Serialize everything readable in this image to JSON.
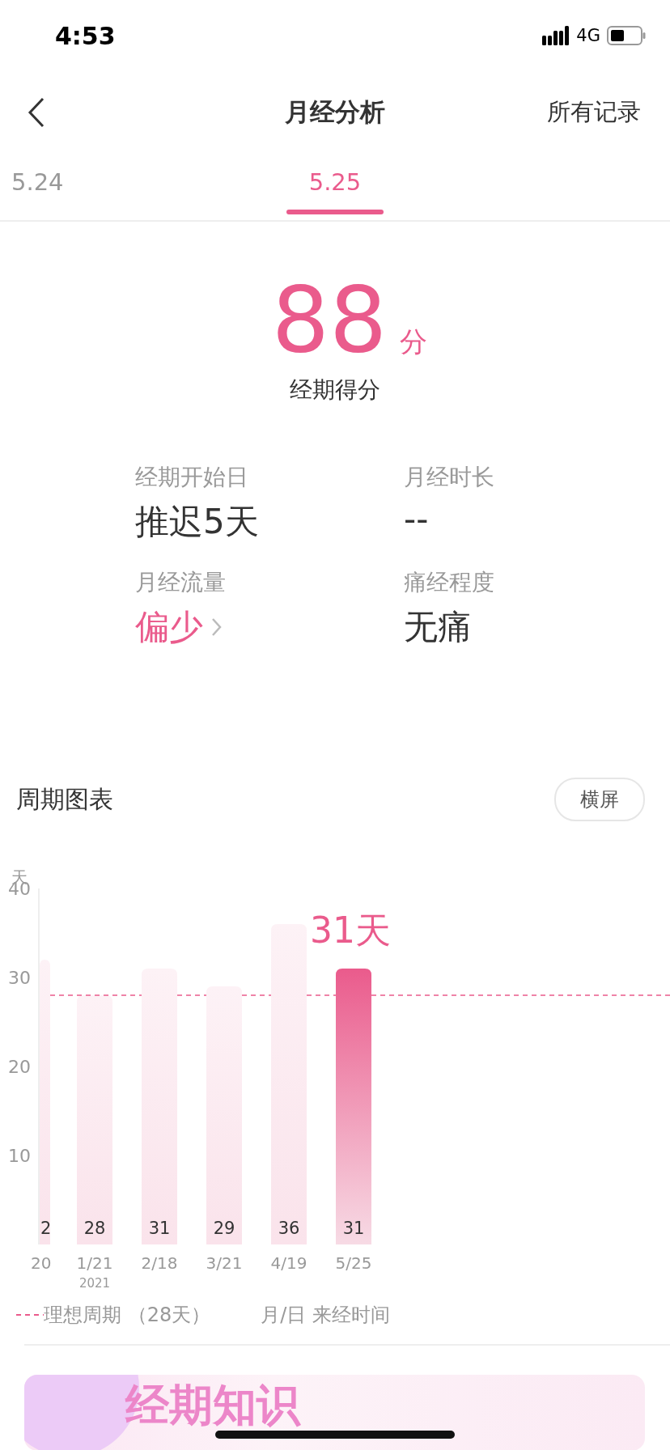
{
  "status_bar": {
    "time": "4:53",
    "network": "4G"
  },
  "nav": {
    "title": "月经分析",
    "action": "所有记录"
  },
  "tabs": [
    {
      "label": "5.24",
      "selected": false
    },
    {
      "label": "5.25",
      "selected": true
    }
  ],
  "score": {
    "value": "88",
    "unit": "分",
    "caption": "经期得分"
  },
  "stats": [
    {
      "label": "经期开始日",
      "value": "推迟5天",
      "link": false
    },
    {
      "label": "月经时长",
      "value": "--",
      "link": false
    },
    {
      "label": "月经流量",
      "value": "偏少",
      "link": true
    },
    {
      "label": "痛经程度",
      "value": "无痛",
      "link": false
    }
  ],
  "cycle_chart": {
    "title": "周期图表",
    "button": "横屏",
    "chart_data": {
      "type": "bar",
      "ylabel": "天",
      "categories": [
        "1/21",
        "2/18",
        "3/21",
        "4/19",
        "5/25"
      ],
      "values": [
        28,
        31,
        29,
        36,
        31
      ],
      "value_labels": [
        "28",
        "31",
        "29",
        "36",
        "31"
      ],
      "ylim": [
        0,
        40
      ],
      "yticks": [
        10,
        20,
        30,
        40
      ],
      "annotations": [
        "31天",
        "2021"
      ]
    },
    "bars": [
      {
        "selected": false
      },
      {
        "selected": false
      },
      {
        "selected": false
      },
      {
        "selected": false
      },
      {
        "selected": true
      }
    ],
    "cut_bar": {
      "value_label": "2",
      "category": "20"
    },
    "ideal_line": {
      "label": "理想周期 （28天）"
    },
    "legend": {
      "axis": "月/日 来经时间"
    }
  },
  "banner": {
    "title": "经期知识"
  }
}
